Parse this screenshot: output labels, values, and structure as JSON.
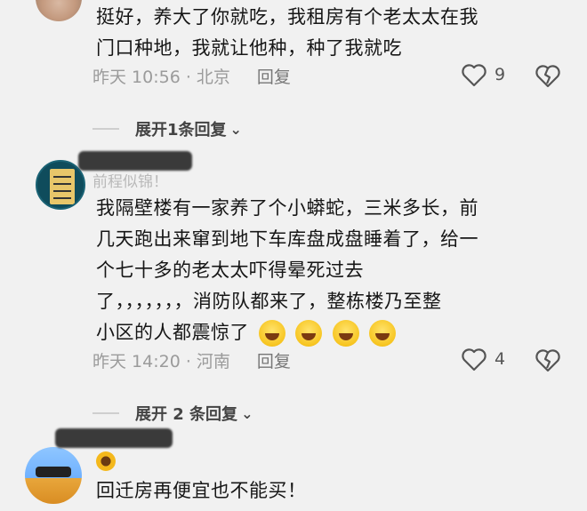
{
  "comments": [
    {
      "text_lines": [
        "挺好，养大了你就吃，我租房有个老太太在我",
        "门口种地，我就让他种，种了我就吃"
      ],
      "time": "昨天 10:56 · 北京",
      "reply_label": "回复",
      "likes": "9",
      "expand_label": "展开1条回复"
    },
    {
      "username": "前程似锦！",
      "text_lines": [
        "我隔壁楼有一家养了个小蟒蛇，三米多长，前",
        "几天跑出来窜到地下车库盘成盘睡着了，给一",
        "个七十多的老太太吓得晕死过去",
        "了，，，，，，，消防队都来了，整栋楼乃至整",
        "小区的人都震惊了"
      ],
      "time": "昨天 14:20 · 河南",
      "reply_label": "回复",
      "likes": "4",
      "expand_label": "展开 2 条回复"
    },
    {
      "text_lines": [
        "回迁房再便宜也不能买！"
      ]
    }
  ],
  "icons": {
    "like": "heart-outline-icon",
    "dislike": "broken-heart-icon",
    "expand": "chevron-down-icon"
  },
  "colors": {
    "background": "#f1f1f1",
    "meta_text": "#9b9b9b"
  }
}
